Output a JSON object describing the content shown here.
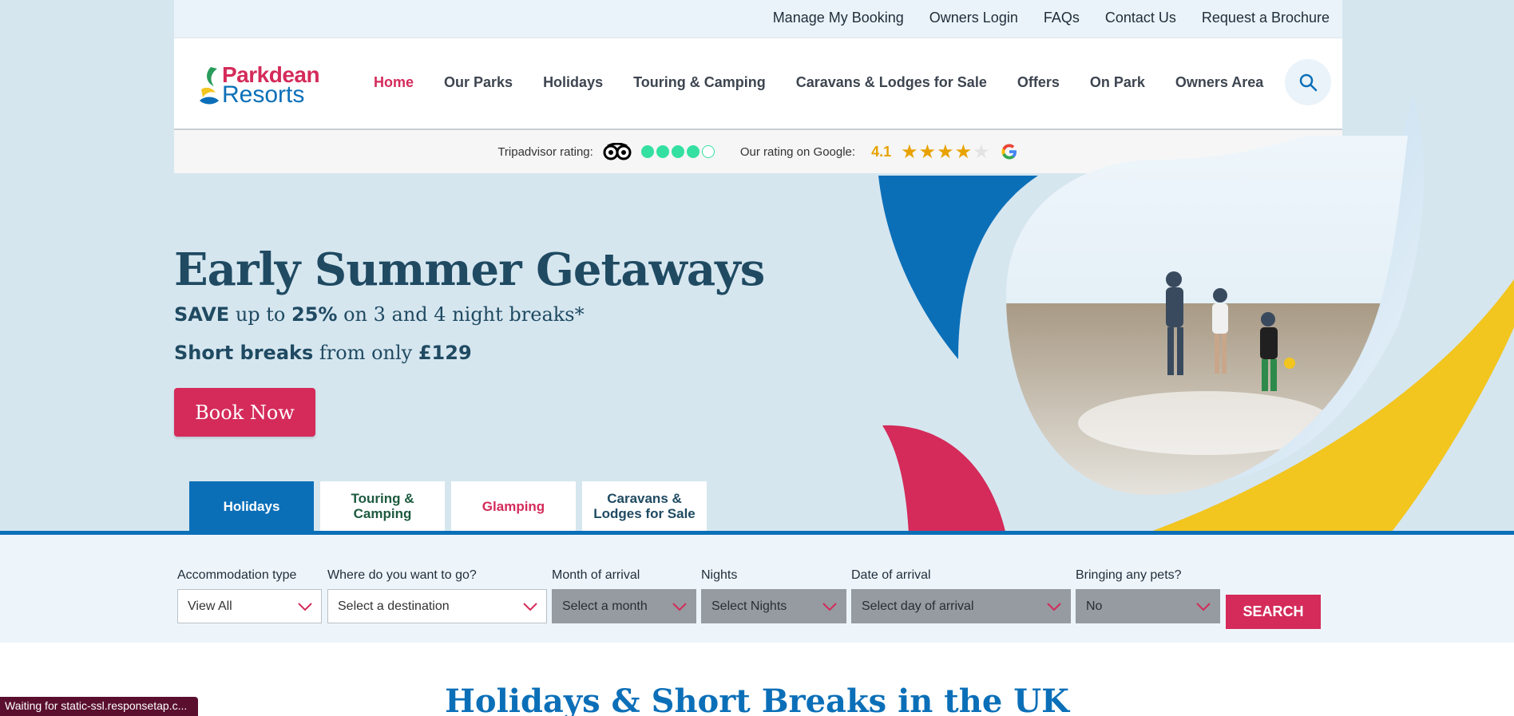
{
  "topbar": {
    "links": [
      "Manage My Booking",
      "Owners Login",
      "FAQs",
      "Contact Us",
      "Request a Brochure"
    ]
  },
  "logo": {
    "word1": "Parkdean",
    "word2": "Resorts"
  },
  "nav": {
    "items": [
      "Home",
      "Our Parks",
      "Holidays",
      "Touring & Camping",
      "Caravans & Lodges for Sale",
      "Offers",
      "On Park",
      "Owners Area"
    ],
    "active": "Home"
  },
  "ratings": {
    "tripadvisor_label": "Tripadvisor rating:",
    "tripadvisor_score": 4,
    "tripadvisor_max": 5,
    "google_label": "Our rating on Google:",
    "google_score": "4.1",
    "google_stars": 4
  },
  "hero": {
    "title": "Early Summer Getaways",
    "line1": {
      "b1": "SAVE",
      "t1": " up to ",
      "b2": "25%",
      "t2": " on 3 and 4 night breaks*"
    },
    "line2": {
      "b1": "Short breaks",
      "t1": " from only ",
      "b2": "£129"
    },
    "cta": "Book Now"
  },
  "tabs": [
    {
      "line1": "Holidays",
      "line2": ""
    },
    {
      "line1": "Touring &",
      "line2": "Camping"
    },
    {
      "line1": "Glamping",
      "line2": ""
    },
    {
      "line1": "Caravans &",
      "line2": "Lodges for Sale"
    }
  ],
  "search": {
    "accommodation": {
      "label": "Accommodation type",
      "value": "View All"
    },
    "destination": {
      "label": "Where do you want to go?",
      "value": "Select a destination"
    },
    "month": {
      "label": "Month of arrival",
      "value": "Select a month"
    },
    "nights": {
      "label": "Nights",
      "value": "Select Nights"
    },
    "date": {
      "label": "Date of arrival",
      "value": "Select day of arrival"
    },
    "pets": {
      "label": "Bringing any pets?",
      "value": "No"
    },
    "button": "SEARCH"
  },
  "section": {
    "heading": "Holidays & Short Breaks in the UK"
  },
  "status": "Waiting for static-ssl.responsetap.c...",
  "colors": {
    "brand_pink": "#d42b5a",
    "brand_blue": "#0b6fb8",
    "brand_yellow": "#f2c51f",
    "tripadvisor_green": "#34e0a1"
  }
}
